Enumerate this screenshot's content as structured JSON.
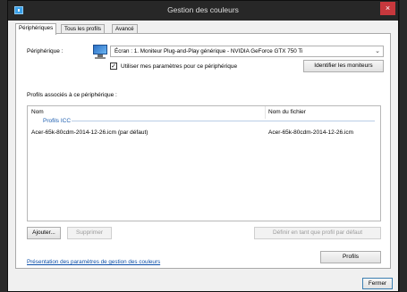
{
  "window": {
    "title": "Gestion des couleurs",
    "close_glyph": "×"
  },
  "tabs": [
    {
      "label": "Périphériques",
      "active": true
    },
    {
      "label": "Tous les profils",
      "active": false
    },
    {
      "label": "Avancé",
      "active": false
    }
  ],
  "device": {
    "label": "Périphérique :",
    "selected": "Écran : 1. Moniteur Plug-and-Play générique - NVIDIA GeForce GTX 750 Ti",
    "chevron": "⌄",
    "use_settings_label": "Utiliser mes paramètres pour ce périphérique",
    "use_settings_checked": "✓",
    "identify_button": "Identifier les moniteurs"
  },
  "profiles": {
    "section_label": "Profils associés à ce périphérique :",
    "columns": [
      "Nom",
      "Nom du fichier"
    ],
    "group": "Profils ICC",
    "rows": [
      {
        "name": "Acer-65k-80cdm-2014-12-26.icm (par défaut)",
        "file": "Acer-65k-80cdm-2014-12-26.icm"
      }
    ]
  },
  "actions": {
    "add": "Ajouter...",
    "remove": "Supprimer",
    "set_default": "Définir en tant que profil par défaut"
  },
  "footer": {
    "link": "Présentation des paramètres de gestion des couleurs",
    "profiles_button": "Profils",
    "close_button": "Fermer"
  },
  "colors": {
    "titlebar": "#272727",
    "close": "#c7383d",
    "link": "#0a4da8",
    "group": "#1e5fb0"
  }
}
